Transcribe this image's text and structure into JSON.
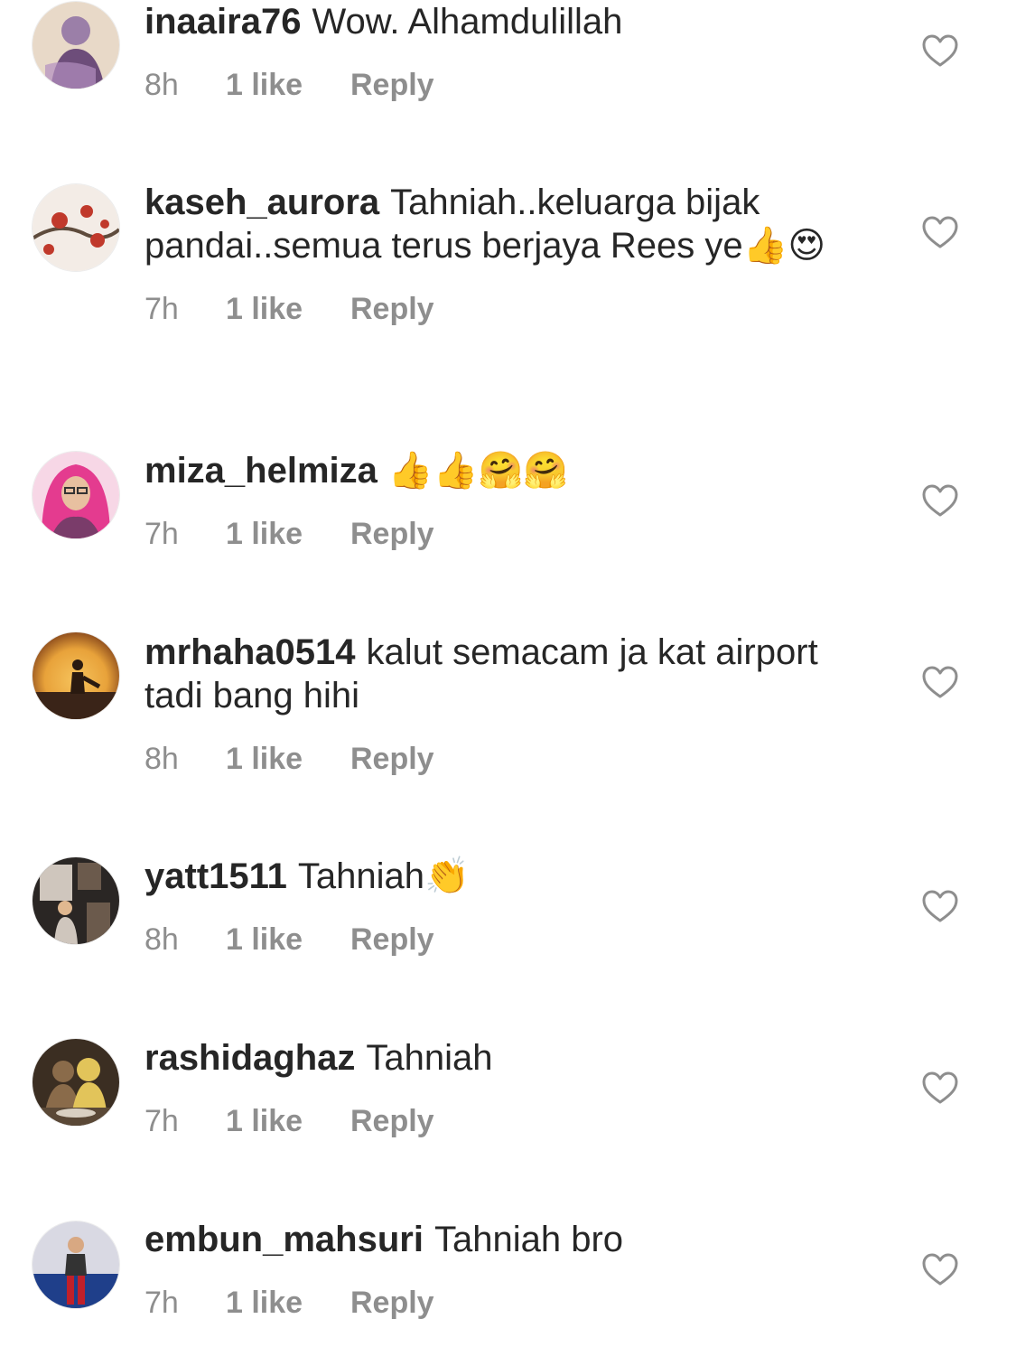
{
  "comments": [
    {
      "username": "inaaira76",
      "text": "Wow. Alhamdulillah",
      "time": "8h",
      "likes": "1 like",
      "reply": "Reply",
      "colors": [
        "#9b7fa8",
        "#e8d9c8",
        "#6d4d7a"
      ]
    },
    {
      "username": "kaseh_aurora",
      "text": "Tahniah..keluarga bijak pandai..semua terus berjaya Rees ye👍😍",
      "time": "7h",
      "likes": "1 like",
      "reply": "Reply",
      "colors": [
        "#f3ece6",
        "#c0392b",
        "#5e4b3c"
      ]
    },
    {
      "username": "miza_helmiza",
      "text": "👍👍🤗🤗",
      "time": "7h",
      "likes": "1 like",
      "reply": "Reply",
      "colors": [
        "#e43b8f",
        "#f7d7e6",
        "#7a3c6a"
      ]
    },
    {
      "username": "mrhaha0514",
      "text": "kalut semacam ja kat airport tadi bang hihi",
      "time": "8h",
      "likes": "1 like",
      "reply": "Reply",
      "colors": [
        "#e8a23a",
        "#3a2418",
        "#f6c35c"
      ]
    },
    {
      "username": "yatt1511",
      "text": "Tahniah👏",
      "time": "8h",
      "likes": "1 like",
      "reply": "Reply",
      "colors": [
        "#2a2624",
        "#cfc6bd",
        "#6b5a4c"
      ]
    },
    {
      "username": "rashidaghaz",
      "text": "Tahniah",
      "time": "7h",
      "likes": "1 like",
      "reply": "Reply",
      "colors": [
        "#3b2e22",
        "#e2c45a",
        "#8a6b4a"
      ]
    },
    {
      "username": "embun_mahsuri",
      "text": "Tahniah bro",
      "time": "7h",
      "likes": "1 like",
      "reply": "Reply",
      "colors": [
        "#1f3f8a",
        "#d9d9e3",
        "#c0202a"
      ]
    }
  ],
  "icons": {
    "like": "heart-outline-icon"
  },
  "theme": {
    "text": "#262626",
    "muted": "#8e8e8e",
    "background": "#ffffff"
  }
}
